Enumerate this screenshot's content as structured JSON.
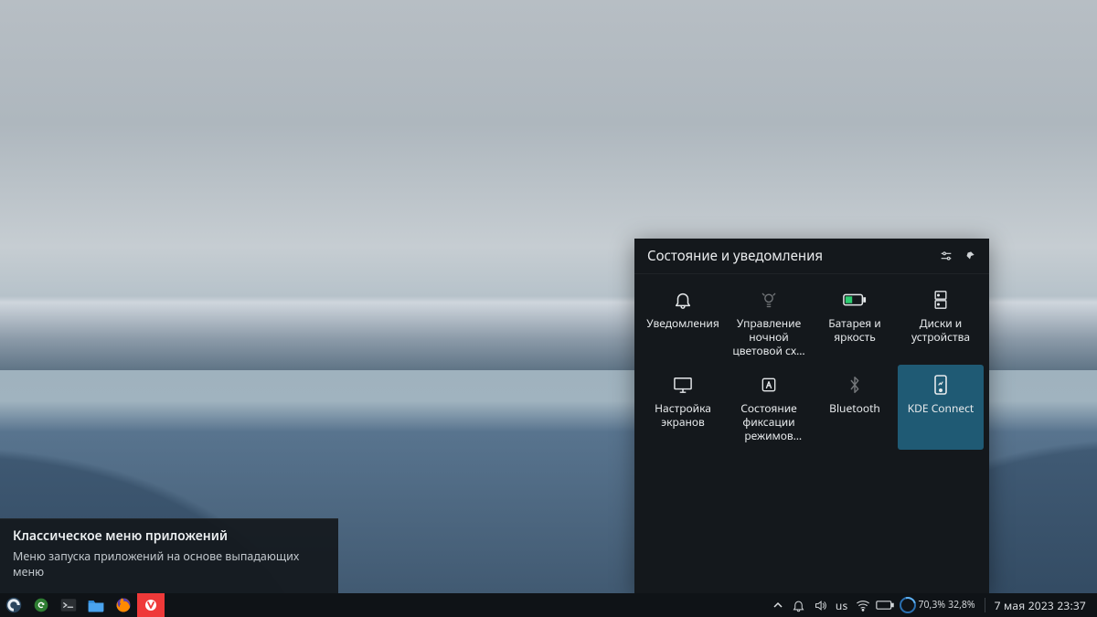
{
  "tooltip": {
    "title": "Классическое меню приложений",
    "body": "Меню запуска приложений на основе выпадающих меню"
  },
  "tray_panel": {
    "title": "Состояние и уведомления",
    "items": [
      {
        "label": "Уведомления",
        "icon": "bell",
        "dim": false,
        "selected": false
      },
      {
        "label": "Управление ночной цветовой сх…",
        "icon": "bulb",
        "dim": true,
        "selected": false
      },
      {
        "label": "Батарея и яркость",
        "icon": "battery",
        "dim": false,
        "selected": false
      },
      {
        "label": "Диски и устройства",
        "icon": "drive",
        "dim": false,
        "selected": false
      },
      {
        "label": "Настройка экранов",
        "icon": "display",
        "dim": false,
        "selected": false
      },
      {
        "label": "Состояние фиксации режимов кла…",
        "icon": "keylock",
        "dim": false,
        "selected": false
      },
      {
        "label": "Bluetooth",
        "icon": "bluetooth",
        "dim": true,
        "selected": false
      },
      {
        "label": "KDE Connect",
        "icon": "phone",
        "dim": false,
        "selected": true
      }
    ]
  },
  "taskbar": {
    "launchers": [
      {
        "name": "app-launcher",
        "icon": "kde"
      },
      {
        "name": "updater",
        "icon": "refresh"
      },
      {
        "name": "terminal",
        "icon": "terminal"
      },
      {
        "name": "file-manager",
        "icon": "folder"
      },
      {
        "name": "firefox",
        "icon": "firefox"
      },
      {
        "name": "vivaldi",
        "icon": "vivaldi"
      }
    ],
    "tray": {
      "keyboard_layout": "us",
      "cpu_percent": "70,3%",
      "mem_percent": "32,8%",
      "clock": "7 мая 2023  23:37"
    }
  }
}
